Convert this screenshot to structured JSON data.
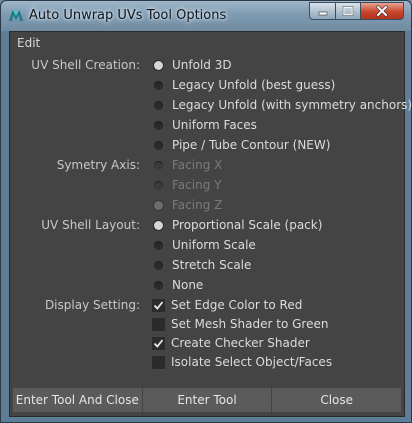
{
  "window": {
    "title": "Auto Unwrap UVs Tool Options"
  },
  "menubar": {
    "items": [
      "Edit"
    ]
  },
  "sections": {
    "uv_shell_creation": {
      "label": "UV Shell Creation:",
      "options": [
        {
          "label": "Unfold 3D",
          "selected": true
        },
        {
          "label": "Legacy Unfold  (best guess)",
          "selected": false
        },
        {
          "label": "Legacy Unfold  (with symmetry anchors)",
          "selected": false
        },
        {
          "label": "Uniform Faces",
          "selected": false
        },
        {
          "label": "Pipe / Tube Contour (NEW)",
          "selected": false
        }
      ]
    },
    "symmetry_axis": {
      "label": "Symetry Axis:",
      "options": [
        {
          "label": "Facing X",
          "selected": false,
          "disabled": true
        },
        {
          "label": "Facing Y",
          "selected": false,
          "disabled": true
        },
        {
          "label": "Facing Z",
          "selected": true,
          "disabled": true
        }
      ]
    },
    "uv_shell_layout": {
      "label": "UV Shell Layout:",
      "options": [
        {
          "label": "Proportional Scale (pack)",
          "selected": true
        },
        {
          "label": "Uniform Scale",
          "selected": false
        },
        {
          "label": "Stretch Scale",
          "selected": false
        },
        {
          "label": "None",
          "selected": false
        }
      ]
    },
    "display_setting": {
      "label": "Display Setting:",
      "options": [
        {
          "label": "Set Edge Color to Red",
          "checked": true
        },
        {
          "label": "Set Mesh Shader to Green",
          "checked": false
        },
        {
          "label": "Create Checker Shader",
          "checked": true
        },
        {
          "label": "Isolate Select Object/Faces",
          "checked": false
        }
      ]
    }
  },
  "buttons": {
    "enter_and_close": "Enter Tool And Close",
    "enter": "Enter Tool",
    "close": "Close"
  },
  "icons": {
    "app": "maya-app-icon",
    "minimize": "minimize-icon",
    "maximize": "maximize-icon",
    "close": "close-icon",
    "radio": "radio-button",
    "check": "checkmark-icon"
  },
  "colors": {
    "panel_bg": "#444444",
    "button_bg": "#5b5b5b",
    "text": "#dcdcdc",
    "disabled_text": "#7a7a7a",
    "close_button": "#c7452b"
  }
}
